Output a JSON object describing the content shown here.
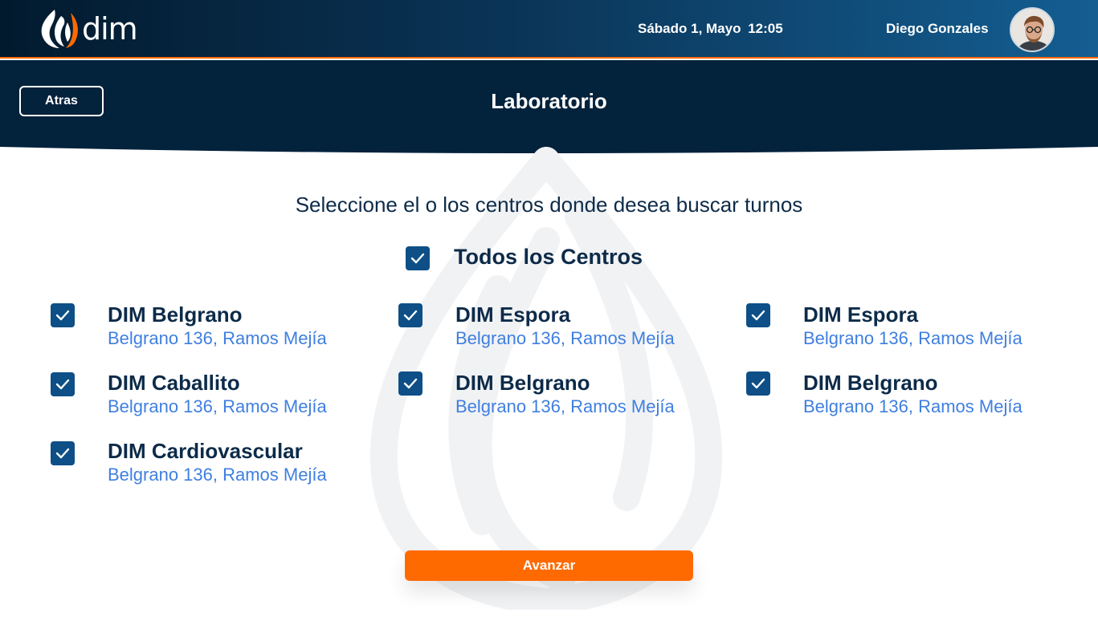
{
  "app": {
    "logo_text": "dim"
  },
  "header": {
    "date": "Sábado 1, Mayo",
    "time": "12:05",
    "user_name": "Diego Gonzales"
  },
  "page": {
    "back_label": "Atras",
    "title": "Laboratorio",
    "prompt": "Seleccione el o los centros donde desea buscar turnos"
  },
  "select_all": {
    "label": "Todos los Centros",
    "checked": true
  },
  "centers": [
    {
      "name": "DIM Belgrano",
      "address": "Belgrano 136, Ramos Mejía",
      "checked": true
    },
    {
      "name": "DIM Espora",
      "address": "Belgrano 136, Ramos Mejía",
      "checked": true
    },
    {
      "name": "DIM Espora",
      "address": "Belgrano 136, Ramos Mejía",
      "checked": true
    },
    {
      "name": "DIM Caballito",
      "address": "Belgrano 136, Ramos Mejía",
      "checked": true
    },
    {
      "name": "DIM Belgrano",
      "address": "Belgrano 136, Ramos Mejía",
      "checked": true
    },
    {
      "name": "DIM Belgrano",
      "address": "Belgrano 136, Ramos Mejía",
      "checked": true
    },
    {
      "name": "DIM Cardiovascular",
      "address": "Belgrano 136, Ramos Mejía",
      "checked": true
    }
  ],
  "actions": {
    "advance_label": "Avanzar"
  },
  "colors": {
    "accent": "#ff6a00",
    "navy": "#0d2b49",
    "checkbox": "#0d4f86",
    "address": "#3f7fe0"
  },
  "icons": {
    "logo": "flame-logo-icon",
    "check": "check-icon",
    "avatar": "user-avatar"
  }
}
